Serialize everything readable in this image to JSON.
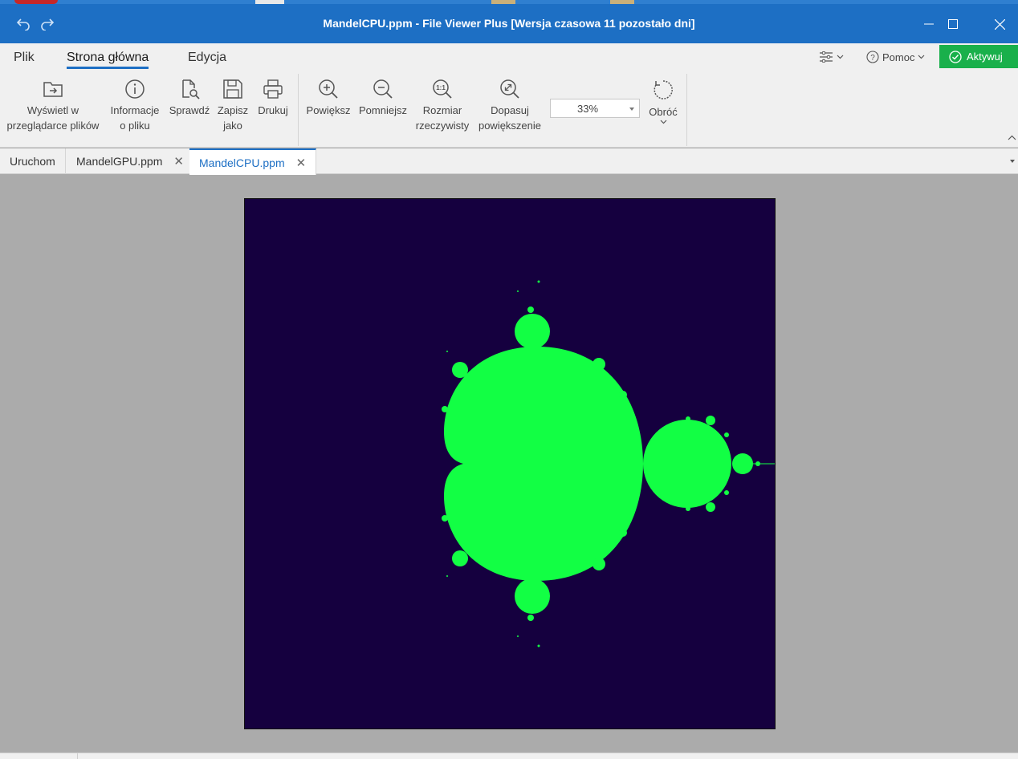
{
  "window": {
    "title": "MandelCPU.ppm - File Viewer Plus [Wersja czasowa 11 pozostało dni]"
  },
  "menu": {
    "tabs": [
      {
        "label": "Plik",
        "active": false
      },
      {
        "label": "Strona główna",
        "active": true
      },
      {
        "label": "Edycja",
        "active": false
      }
    ],
    "help_label": "Pomoc",
    "activate_label": "Aktywuj"
  },
  "ribbon": {
    "open_in_browser": {
      "line1": "Wyświetl w",
      "line2": "przeglądarce plików",
      "icon": "folder-arrow-icon"
    },
    "file_info": {
      "line1": "Informacje",
      "line2": "o pliku",
      "icon": "info-icon"
    },
    "check": {
      "line1": "Sprawdź",
      "icon": "file-search-icon"
    },
    "save_as": {
      "line1": "Zapisz",
      "line2": "jako",
      "icon": "save-icon"
    },
    "print": {
      "line1": "Drukuj",
      "icon": "printer-icon"
    },
    "zoom_in": {
      "line1": "Powiększ",
      "icon": "zoom-in-icon"
    },
    "zoom_out": {
      "line1": "Pomniejsz",
      "icon": "zoom-out-icon"
    },
    "actual_size": {
      "line1": "Rozmiar",
      "line2": "rzeczywisty",
      "icon": "actual-size-icon"
    },
    "fit_zoom": {
      "line1": "Dopasuj",
      "line2": "powiększenie",
      "icon": "fit-zoom-icon"
    },
    "zoom_value": "33%",
    "rotate": {
      "line1": "Obróć",
      "icon": "rotate-icon"
    }
  },
  "doc_tabs": [
    {
      "label": "Uruchom",
      "closable": false,
      "active": false
    },
    {
      "label": "MandelGPU.ppm",
      "closable": true,
      "active": false
    },
    {
      "label": "MandelCPU.ppm",
      "closable": true,
      "active": true
    }
  ],
  "image": {
    "background_color": "#15003f",
    "set_color": "#12ff44"
  },
  "colors": {
    "accent": "#1d6fc4",
    "activate": "#19b04b"
  }
}
